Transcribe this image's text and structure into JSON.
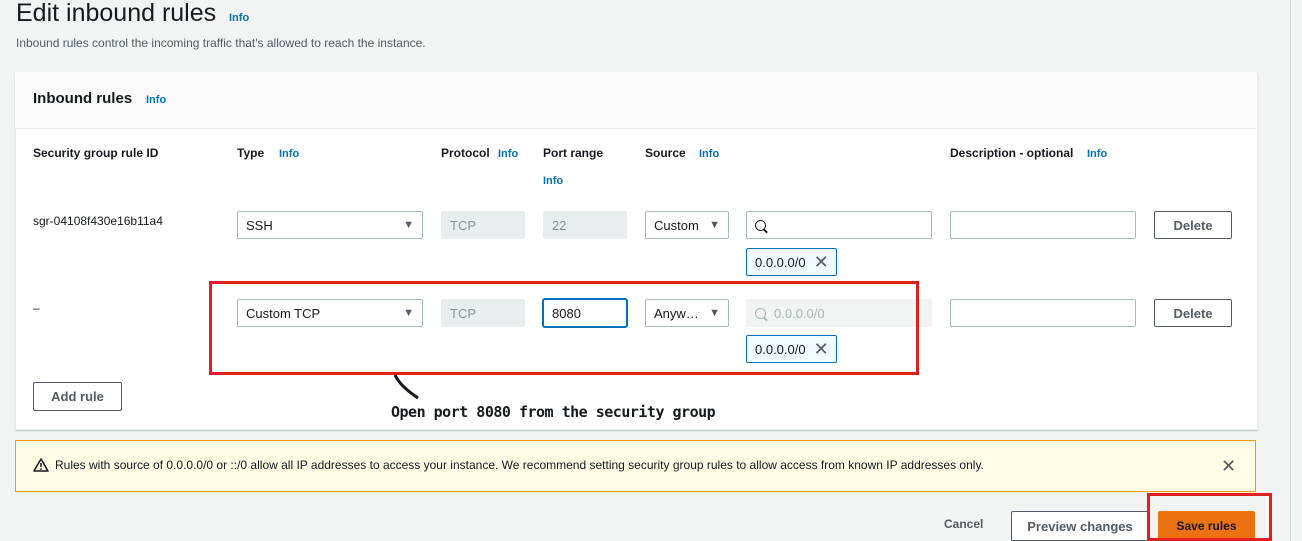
{
  "page": {
    "title": "Edit inbound rules",
    "title_info": "Info",
    "description": "Inbound rules control the incoming traffic that's allowed to reach the instance."
  },
  "card": {
    "title": "Inbound rules",
    "info": "Info"
  },
  "columns": {
    "rule_id": "Security group rule ID",
    "type": "Type",
    "type_info": "Info",
    "protocol": "Protocol",
    "protocol_info": "Info",
    "port_range": "Port range",
    "port_info": "Info",
    "source": "Source",
    "source_info": "Info",
    "description": "Description - optional",
    "description_info": "Info"
  },
  "rules": [
    {
      "id": "sgr-04108f430e16b11a4",
      "type": "SSH",
      "protocol": "TCP",
      "port": "22",
      "source": "Custom",
      "search_value": "",
      "token": "0.0.0.0/0",
      "description": "",
      "delete_label": "Delete"
    },
    {
      "id": "–",
      "type": "Custom TCP",
      "protocol": "TCP",
      "port": "8080",
      "source": "Anyw…",
      "search_placeholder": "0.0.0.0/0",
      "token": "0.0.0.0/0",
      "description": "",
      "delete_label": "Delete"
    }
  ],
  "add_rule_label": "Add rule",
  "annotation": "Open port 8080 from the security group",
  "alert": {
    "text": "Rules with source of 0.0.0.0/0 or ::/0 allow all IP addresses to access your instance. We recommend setting security group rules to allow access from known IP addresses only."
  },
  "footer": {
    "cancel": "Cancel",
    "preview": "Preview changes",
    "save": "Save rules"
  },
  "colors": {
    "accent": "#0073bb",
    "primary_button": "#ec7211",
    "annotation": "#e02020",
    "warning": "#ff9900"
  },
  "icons": [
    "dropdown-caret-icon",
    "search-icon",
    "close-icon",
    "warning-icon"
  ]
}
